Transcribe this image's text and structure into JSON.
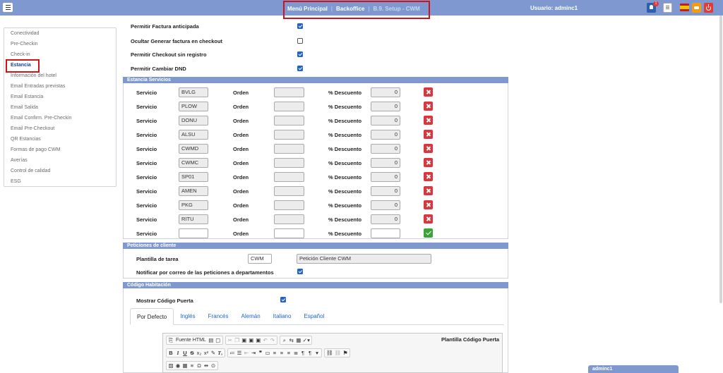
{
  "topbar": {
    "nav": [
      "Menú Principal",
      "Backoffice",
      "B.9. Setup - CWM"
    ],
    "user_label": "Usuario: adminc1",
    "notification_count": "1"
  },
  "sidebar": {
    "items": [
      "Conectividad",
      "Pre-Checkin",
      "Check-in",
      "Estancia",
      "Información del hotel",
      "Email Entradas previstas",
      "Email Estancia",
      "Email Salida",
      "Email Confirm. Pre-Checkin",
      "Email Pre-Checkout",
      "QR Estancias",
      "Formas de pago CWM",
      "Averías",
      "Control de calidad",
      "ESG"
    ],
    "active_index": 3
  },
  "options": [
    {
      "label": "Permitir Factura anticipada",
      "checked": true
    },
    {
      "label": "Ocultar Generar factura en checkout",
      "checked": false
    },
    {
      "label": "Permitir Checkout sin registro",
      "checked": true
    },
    {
      "label": "Permitir Cambiar DND",
      "checked": true
    }
  ],
  "estancia_servicios": {
    "title": "Estancia Servicios",
    "servicio_label": "Servicio",
    "orden_label": "Orden",
    "descuento_label": "% Descuento",
    "rows": [
      {
        "servicio": "BVLG",
        "orden": "",
        "descuento": "0"
      },
      {
        "servicio": "PLOW",
        "orden": "",
        "descuento": "0"
      },
      {
        "servicio": "DONU",
        "orden": "",
        "descuento": "0"
      },
      {
        "servicio": "ALSU",
        "orden": "",
        "descuento": "0"
      },
      {
        "servicio": "CWMD",
        "orden": "",
        "descuento": "0"
      },
      {
        "servicio": "CWMC",
        "orden": "",
        "descuento": "0"
      },
      {
        "servicio": "SP01",
        "orden": "",
        "descuento": "0"
      },
      {
        "servicio": "AMEN",
        "orden": "",
        "descuento": "0"
      },
      {
        "servicio": "PKG",
        "orden": "",
        "descuento": "0"
      },
      {
        "servicio": "RITU",
        "orden": "",
        "descuento": "0"
      }
    ],
    "new_row": {
      "servicio": "",
      "orden": "",
      "descuento": ""
    }
  },
  "peticiones": {
    "title": "Peticiones de cliente",
    "plantilla_label": "Plantilla de tarea",
    "plantilla_code": "CWM",
    "plantilla_name": "Petición Cliente CWM",
    "notificar_label": "Notificar por correo de las peticiones a departamentos",
    "notificar_checked": true
  },
  "codigo": {
    "title": "Código Habitación",
    "mostrar_label": "Mostrar Código Puerta",
    "mostrar_checked": true,
    "tabs": [
      "Por Defecto",
      "Inglés",
      "Francés",
      "Alemán",
      "Italiano",
      "Español"
    ],
    "active_tab": 0,
    "editor_label": "Plantilla Código Puerta",
    "fuente_html": "Fuente HTML"
  },
  "popup": {
    "title": "adminc1"
  }
}
